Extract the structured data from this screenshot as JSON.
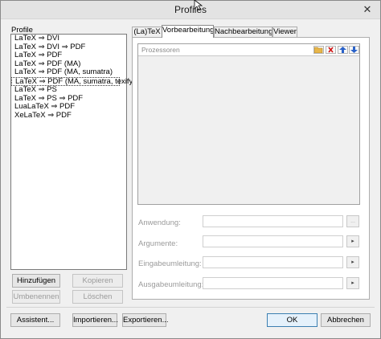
{
  "window": {
    "title": "Profiles",
    "close": "✕"
  },
  "profiles": {
    "label": "Profile",
    "items": [
      "LaTeX ⇒ DVI",
      "LaTeX ⇒ DVI ⇒ PDF",
      "LaTeX ⇒ PDF",
      "LaTeX ⇒ PDF (MA)",
      "LaTeX ⇒ PDF (MA, sumatra)",
      "LaTeX ⇒ PDF (MA, sumatra, texify)",
      "LaTeX ⇒ PS",
      "LaTeX ⇒ PS ⇒ PDF",
      "LuaLaTeX ⇒ PDF",
      "XeLaTeX ⇒ PDF"
    ],
    "selected_index": 5,
    "buttons": {
      "add": "Hinzufügen",
      "copy": "Kopieren",
      "rename": "Umbenennen",
      "delete": "Löschen"
    }
  },
  "tabs": [
    "(La)TeX",
    "Vorbearbeitung",
    "Nachbearbeitung",
    "Viewer"
  ],
  "active_tab": 1,
  "processors": {
    "title": "Prozessoren"
  },
  "fields": {
    "anwendung": "Anwendung:",
    "argumente": "Argumente:",
    "eingabe": "Eingabeumleitung:",
    "ausgabe": "Ausgabeumleitung:",
    "browse": "...",
    "arrow": "▸"
  },
  "footer": {
    "assistant": "Assistent...",
    "import": "Importieren...",
    "export": "Exportieren...",
    "ok": "OK",
    "cancel": "Abbrechen"
  }
}
